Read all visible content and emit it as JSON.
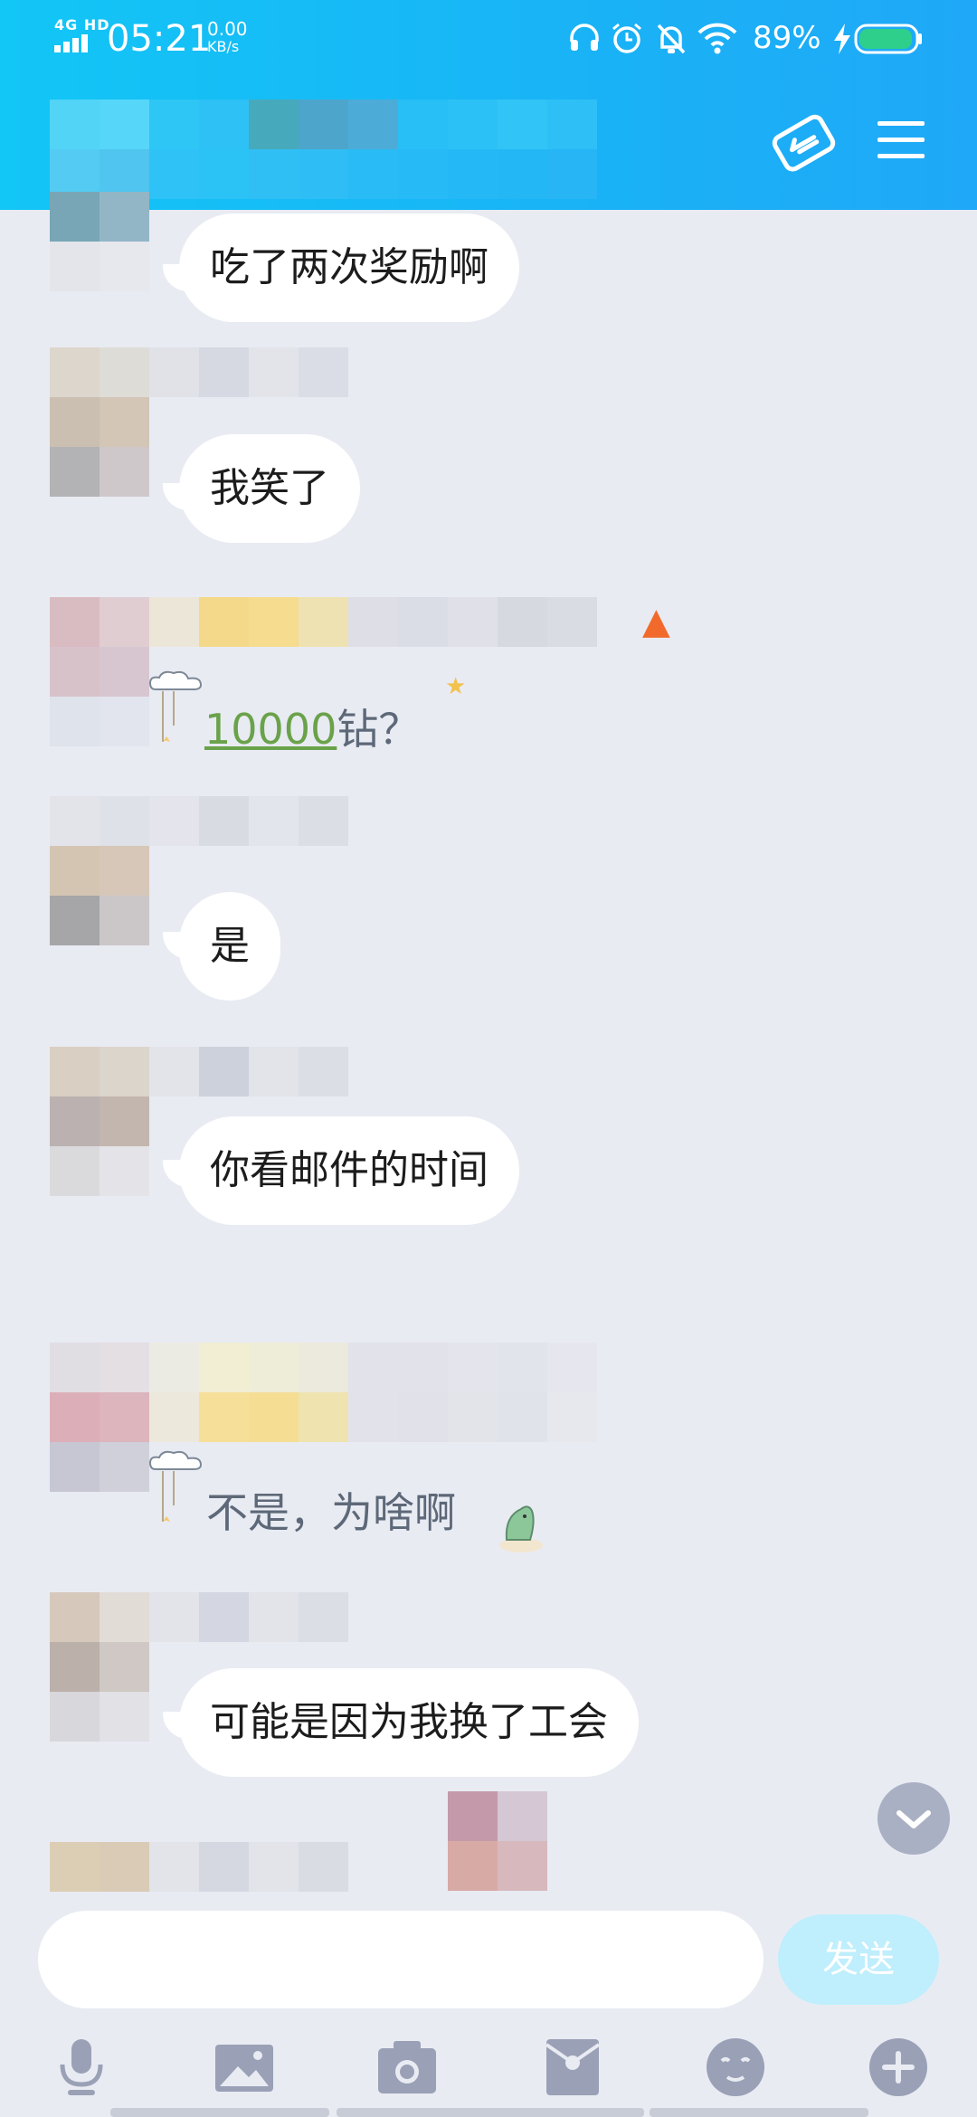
{
  "status_bar": {
    "network": "4G HD",
    "time": "05:21",
    "speed_value": "0.00",
    "speed_unit": "KB/s",
    "battery": "89%",
    "icons": [
      "headphones-icon",
      "alarm-icon",
      "mute-icon",
      "wifi-icon",
      "charging-icon",
      "battery-icon"
    ]
  },
  "header": {
    "icons": [
      "transfer-icon",
      "menu-icon"
    ]
  },
  "messages": [
    {
      "type": "bubble",
      "text": "吃了两次奖励啊"
    },
    {
      "type": "bubble",
      "text": "我笑了"
    },
    {
      "type": "fancy",
      "highlight": "10000",
      "rest": "钻？"
    },
    {
      "type": "bubble",
      "text": "是"
    },
    {
      "type": "bubble",
      "text": "你看邮件的时间"
    },
    {
      "type": "fancy",
      "text": "不是，为啥啊"
    },
    {
      "type": "bubble",
      "text": "可能是因为我换了工会"
    }
  ],
  "composer": {
    "input_value": "",
    "send_label": "发送"
  },
  "toolbar": {
    "icons": [
      "microphone-icon",
      "image-icon",
      "camera-icon",
      "red-packet-icon",
      "emoji-icon",
      "plus-icon"
    ]
  },
  "colors": {
    "header": "#19b4f6",
    "background": "#e9ebf3",
    "link_green": "#6aa24a",
    "send_button": "#bfeefc"
  }
}
